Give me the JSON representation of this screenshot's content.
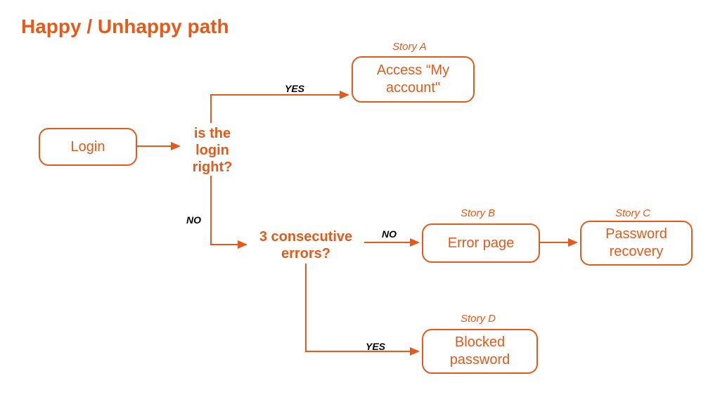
{
  "title": "Happy / Unhappy path",
  "nodes": {
    "login": {
      "label": "Login"
    },
    "access": {
      "label": "Access “My account\"",
      "story": "Story A"
    },
    "error_page": {
      "label": "Error page",
      "story": "Story B"
    },
    "password_recovery": {
      "label": "Password recovery",
      "story": "Story C"
    },
    "blocked_password": {
      "label": "Blocked password",
      "story": "Story D"
    }
  },
  "decisions": {
    "login_right": {
      "label": "is the login right?"
    },
    "three_errors": {
      "label": "3 consecutive errors?"
    }
  },
  "edge_labels": {
    "login_right_yes": "YES",
    "login_right_no": "NO",
    "three_errors_no": "NO",
    "three_errors_yes": "YES"
  },
  "colors": {
    "accent": "#e55a1b"
  }
}
